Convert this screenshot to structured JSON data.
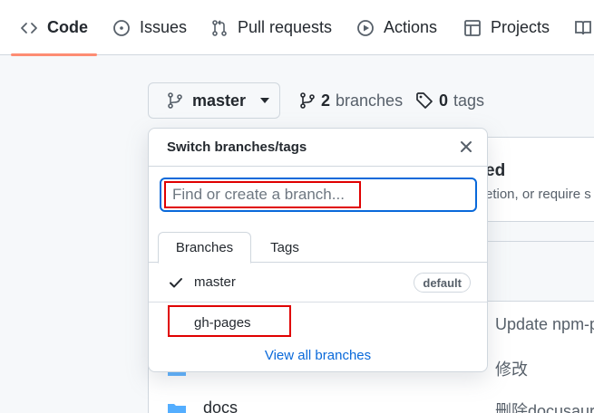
{
  "nav": {
    "tabs": [
      {
        "label": "Code",
        "icon": "code-icon"
      },
      {
        "label": "Issues",
        "icon": "issue-opened-icon"
      },
      {
        "label": "Pull requests",
        "icon": "git-pull-request-icon"
      },
      {
        "label": "Actions",
        "icon": "play-icon"
      },
      {
        "label": "Projects",
        "icon": "table-icon"
      },
      {
        "label": "",
        "icon": "book-icon"
      }
    ],
    "accent": "#fd8c73"
  },
  "repo": {
    "current_branch": "master",
    "branches_count": "2",
    "branches_label": "branches",
    "tags_count": "0",
    "tags_label": "tags"
  },
  "background": {
    "box_title": "ed",
    "box_text": "etion, or require s",
    "commits": [
      "Update npm-p",
      "修改",
      "删除docusauru"
    ],
    "file_name": "docs"
  },
  "dropdown": {
    "title": "Switch branches/tags",
    "filter_placeholder": "Find or create a branch...",
    "filter_value": "",
    "tabs": [
      "Branches",
      "Tags"
    ],
    "branches": [
      {
        "name": "master",
        "badge": "default",
        "selected": true
      },
      {
        "name": "gh-pages",
        "badge": "",
        "selected": false
      }
    ],
    "footer_link": "View all branches",
    "highlight_color": "#e00000",
    "focus_color": "#0969da"
  }
}
